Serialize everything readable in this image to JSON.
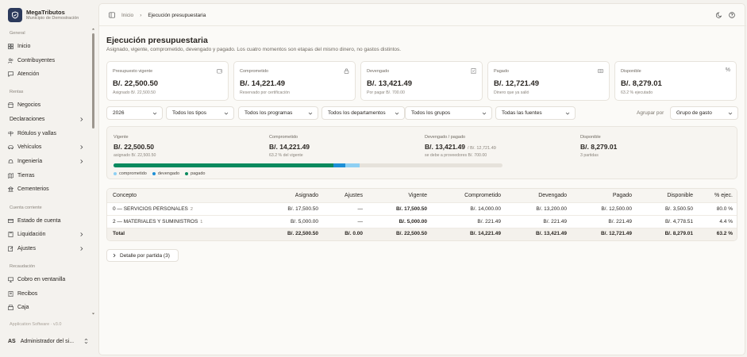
{
  "app": {
    "name": "MegaTributos",
    "subtitle": "Municipio de Demostración"
  },
  "sidebar": {
    "sections": {
      "general": "General",
      "rentas": "Rentas",
      "cuenta": "Cuenta corriente",
      "recaudacion": "Recaudación"
    },
    "items": {
      "inicio": "Inicio",
      "contribuyentes": "Contribuyentes",
      "atencion": "Atención",
      "negocios": "Negocios",
      "declaraciones": "Declaraciones",
      "rotulos": "Rótulos y vallas",
      "vehiculos": "Vehículos",
      "ingenieria": "Ingeniería",
      "tierras": "Tierras",
      "cementerios": "Cementerios",
      "estado": "Estado de cuenta",
      "liquidacion": "Liquidación",
      "ajustes": "Ajustes",
      "cobro": "Cobro en ventanilla",
      "recibos": "Recibos",
      "caja": "Caja"
    },
    "version": "Application Software · v3.0",
    "user": {
      "initials": "AS",
      "name": "Administrador del si..."
    }
  },
  "breadcrumb": {
    "home": "Inicio",
    "current": "Ejecución presupuestaria"
  },
  "page": {
    "title": "Ejecución presupuestaria",
    "subtitle": "Asignado, vigente, comprometido, devengado y pagado. Los cuatro momentos son etapas del mismo dinero, no gastos distintos."
  },
  "cards": [
    {
      "label": "Presupuesto vigente",
      "value": "B/. 22,500.50",
      "note": "Asignado B/. 22,500.50",
      "icon": "wallet-icon"
    },
    {
      "label": "Comprometido",
      "value": "B/. 14,221.49",
      "note": "Reservado por certificación",
      "icon": "lock-icon"
    },
    {
      "label": "Devengado",
      "value": "B/. 13,421.49",
      "note": "Por pagar B/. 700.00",
      "icon": "receipt-icon"
    },
    {
      "label": "Pagado",
      "value": "B/. 12,721.49",
      "note": "Dinero que ya salió",
      "icon": "banknote-icon"
    },
    {
      "label": "Disponible",
      "value": "B/. 8,279.01",
      "note": "63.2 % ejecutado",
      "icon": "percent-icon"
    }
  ],
  "filters": {
    "year": "2026",
    "tipos": "Todos los tipos",
    "programas": "Todos los programas",
    "departamentos": "Todos los departamentos",
    "grupos": "Todos los grupos",
    "fuentes": "Todas las fuentes",
    "group_label": "Agrupar por",
    "group_value": "Grupo de gasto"
  },
  "summary": {
    "vigente": {
      "label": "Vigente",
      "value": "B/. 22,500.50",
      "note": "asignado B/. 22,500.50"
    },
    "comprometido": {
      "label": "Comprometido",
      "value": "B/. 14,221.49",
      "note": "63.2 % del vigente"
    },
    "devengado": {
      "label": "Devengado / pagado",
      "value": "B/. 13,421.49",
      "extra": "/ B/. 12,721.49",
      "note": "se debe a proveedores B/. 700.00"
    },
    "disponible": {
      "label": "Disponible",
      "value": "B/. 8,279.01",
      "note": "3 partidas"
    },
    "progress": {
      "pagado": 0.5654,
      "devengado": 0.5965,
      "comprometido": 0.6321
    },
    "legend": {
      "comprometido": "comprometido",
      "devengado": "devengado",
      "pagado": "pagado"
    },
    "colors": {
      "pagado": "#0b8a5e",
      "devengado": "#1d8fd6",
      "comprometido": "#8fd0f3"
    }
  },
  "table": {
    "headers": {
      "concepto": "Concepto",
      "asignado": "Asignado",
      "ajustes": "Ajustes",
      "vigente": "Vigente",
      "comprometido": "Comprometido",
      "devengado": "Devengado",
      "pagado": "Pagado",
      "disponible": "Disponible",
      "ejec": "% ejec."
    },
    "rows": [
      {
        "concepto": "0 — SERVICIOS PERSONALES",
        "count": "2",
        "asignado": "B/. 17,500.50",
        "ajustes": "—",
        "vigente": "B/. 17,500.50",
        "comprometido": "B/. 14,000.00",
        "devengado": "B/. 13,200.00",
        "pagado": "B/. 12,500.00",
        "disponible": "B/. 3,500.50",
        "ejec": "80.0 %"
      },
      {
        "concepto": "2 — MATERIALES Y SUMINISTROS",
        "count": "1",
        "asignado": "B/. 5,000.00",
        "ajustes": "—",
        "vigente": "B/. 5,000.00",
        "comprometido": "B/. 221.49",
        "devengado": "B/. 221.49",
        "pagado": "B/. 221.49",
        "disponible": "B/. 4,778.51",
        "ejec": "4.4 %"
      }
    ],
    "total": {
      "concepto": "Total",
      "asignado": "B/. 22,500.50",
      "ajustes": "B/. 0.00",
      "vigente": "B/. 22,500.50",
      "comprometido": "B/. 14,221.49",
      "devengado": "B/. 13,421.49",
      "pagado": "B/. 12,721.49",
      "disponible": "B/. 8,279.01",
      "ejec": "63.2 %"
    }
  },
  "detail_button": "Detalle por partida (3)"
}
